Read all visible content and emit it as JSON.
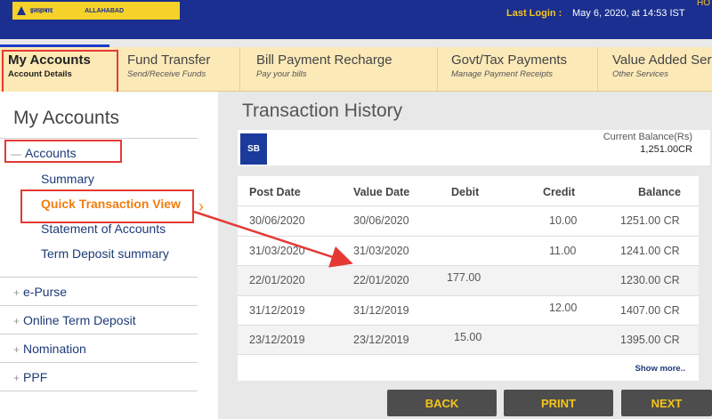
{
  "header": {
    "logo_hindi": "इलाहाबाद",
    "logo_english": "ALLAHABAD",
    "last_login_label": "Last Login :",
    "last_login_value": "May 6, 2020, at 14:53 IST",
    "top_right_text": "HO"
  },
  "tabs": [
    {
      "label": "My Accounts",
      "sub": "Account Details"
    },
    {
      "label": "Fund Transfer",
      "sub": "Send/Receive Funds"
    },
    {
      "label": "Bill Payment Recharge",
      "sub": "Pay your bills"
    },
    {
      "label": "Govt/Tax Payments",
      "sub": "Manage Payment Receipts"
    },
    {
      "label": "Value Added Serv",
      "sub": "Other Services"
    }
  ],
  "sidebar": {
    "title": "My Accounts",
    "accounts_label": "Accounts",
    "sub_items": [
      "Summary",
      "Quick Transaction View",
      "Statement of Accounts",
      "Term Deposit summary"
    ],
    "other_items": [
      "e-Purse",
      "Online Term Deposit",
      "Nomination",
      "PPF"
    ]
  },
  "main": {
    "title": "Transaction History",
    "account_type": "SB",
    "balance_label": "Current Balance(Rs)",
    "balance_value": "1,251.00CR",
    "columns": [
      "Post Date",
      "Value Date",
      "Debit",
      "Credit",
      "Balance"
    ],
    "rows": [
      {
        "post": "30/06/2020",
        "value": "30/06/2020",
        "debit": "",
        "credit": "10.00",
        "balance": "1251.00 CR"
      },
      {
        "post": "31/03/2020",
        "value": "31/03/2020",
        "debit": "",
        "credit": "11.00",
        "balance": "1241.00 CR"
      },
      {
        "post": "22/01/2020",
        "value": "22/01/2020",
        "debit": "177.00",
        "credit": "",
        "balance": "1230.00 CR"
      },
      {
        "post": "31/12/2019",
        "value": "31/12/2019",
        "debit": "",
        "credit": "12.00",
        "balance": "1407.00 CR"
      },
      {
        "post": "23/12/2019",
        "value": "23/12/2019",
        "debit": "15.00",
        "credit": "",
        "balance": "1395.00 CR"
      }
    ],
    "show_more": "Show more..",
    "buttons": {
      "back": "BACK",
      "print": "PRINT",
      "next": "NEXT"
    }
  },
  "colors": {
    "header_blue": "#1a2f8f",
    "tab_bg": "#fbe9b8",
    "active_link": "#f07e10",
    "highlight": "#e53935",
    "button_text": "#f5c518"
  }
}
